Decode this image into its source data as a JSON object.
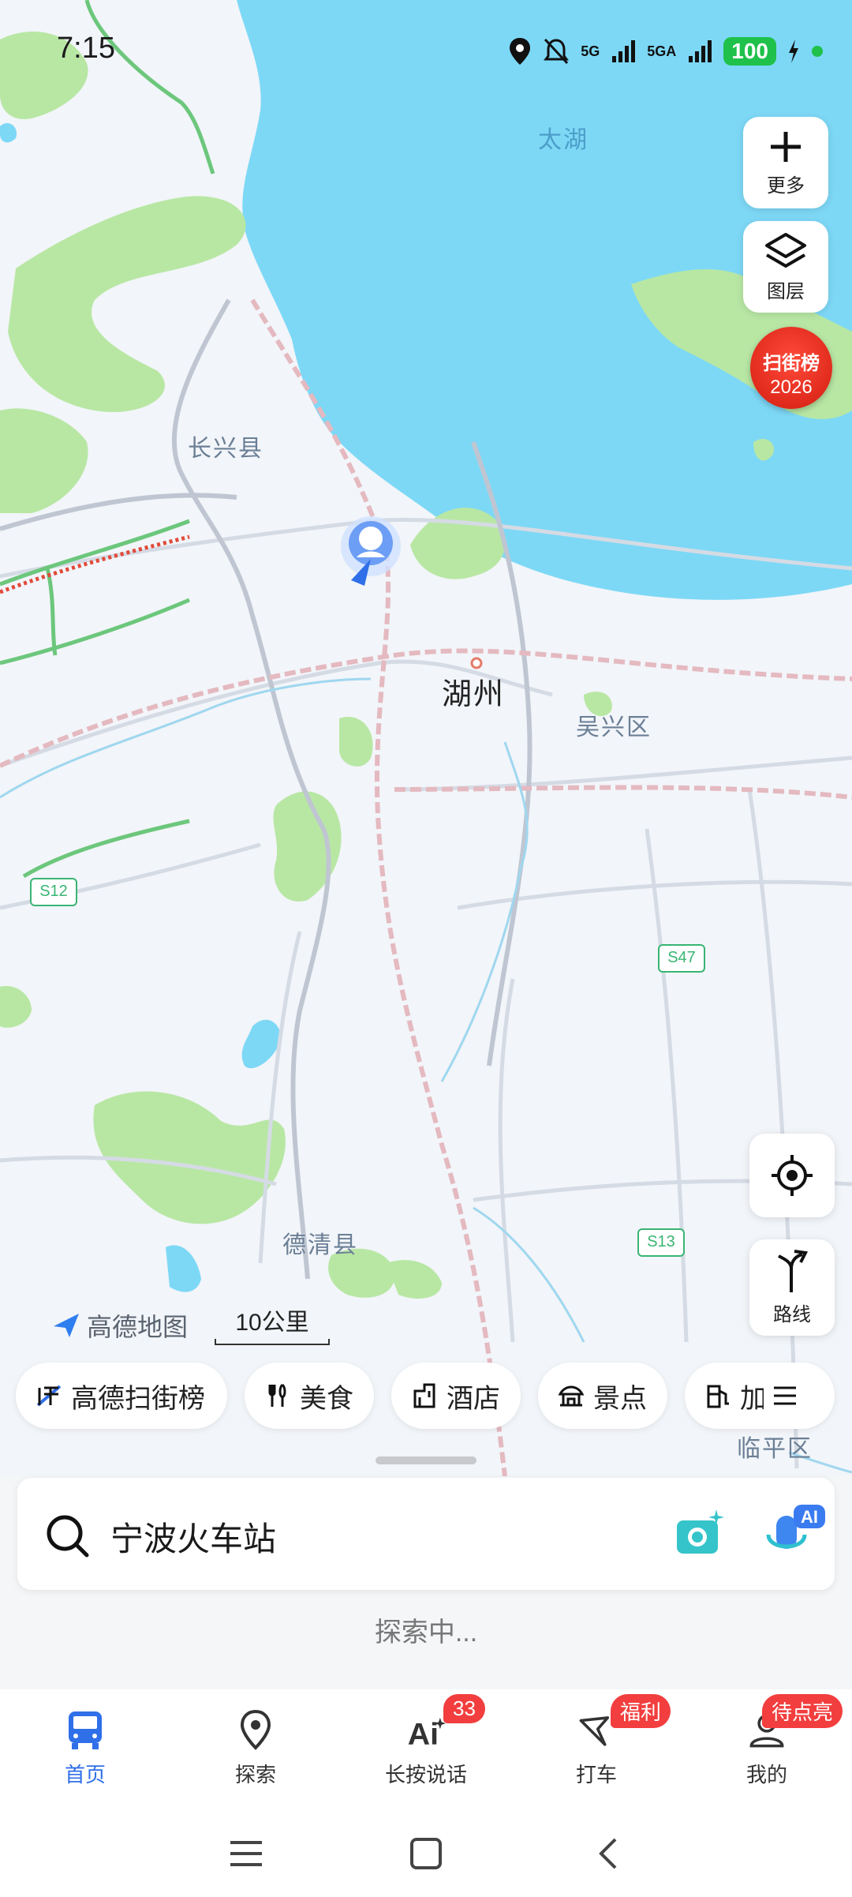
{
  "status_bar": {
    "time": "7:15",
    "battery": "100",
    "network1": "5G",
    "network2": "5GA"
  },
  "map": {
    "labels": {
      "lake": "太湖",
      "changxing": "长兴县",
      "huzhou": "湖州",
      "wuxing": "吴兴区",
      "deqing": "德清县",
      "linping": "临平区"
    },
    "road_shields": {
      "s12": "S12",
      "s47": "S47",
      "s13": "S13"
    },
    "logo_text": "高德地图",
    "scale_label": "10公里"
  },
  "controls": {
    "more_label": "更多",
    "layers_label": "图层",
    "route_label": "路线",
    "badge_title": "扫街榜",
    "badge_year": "2026"
  },
  "chips": [
    {
      "label": "高德扫街榜",
      "icon": "street-rank-icon"
    },
    {
      "label": "美食",
      "icon": "fork-knife-icon"
    },
    {
      "label": "酒店",
      "icon": "hotel-icon"
    },
    {
      "label": "景点",
      "icon": "scenic-spot-icon"
    },
    {
      "label": "加",
      "icon": "gas-station-icon"
    }
  ],
  "search": {
    "query": "宁波火车站"
  },
  "exploring_text": "探索中...",
  "bottom_nav": {
    "items": [
      {
        "label": "首页",
        "active": true
      },
      {
        "label": "探索"
      },
      {
        "label": "长按说话",
        "badge": "33"
      },
      {
        "label": "打车",
        "badge": "福利"
      },
      {
        "label": "我的",
        "badge": "待点亮"
      }
    ]
  },
  "colors": {
    "accent": "#2f6fe8",
    "water": "#7dd8f6",
    "green": "#b8e7a4",
    "badge_red": "#f23e3e",
    "land": "#f2f5f9"
  }
}
